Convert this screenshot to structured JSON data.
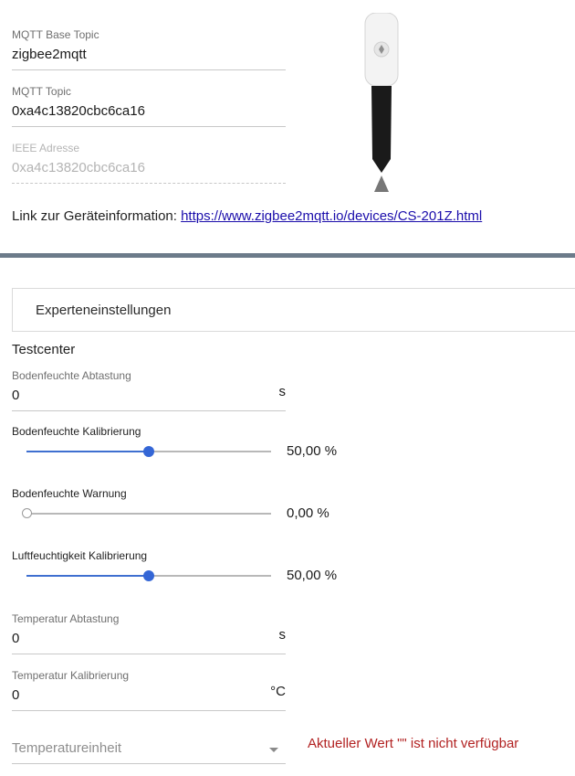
{
  "device_info": {
    "base_topic": {
      "label": "MQTT Base Topic",
      "value": "zigbee2mqtt"
    },
    "topic": {
      "label": "MQTT Topic",
      "value": "0xa4c13820cbc6ca16"
    },
    "ieee": {
      "label": "IEEE Adresse",
      "value": "0xa4c13820cbc6ca16"
    },
    "link_prefix": "Link zur Geräteinformation: ",
    "link_text": "https://www.zigbee2mqtt.io/devices/CS-201Z.html"
  },
  "expert": {
    "label": "Experteneinstellungen"
  },
  "testcenter": {
    "title": "Testcenter",
    "soil_interval": {
      "label": "Bodenfeuchte Abtastung",
      "value": "0",
      "unit": "s"
    },
    "soil_calibration": {
      "label": "Bodenfeuchte Kalibrierung",
      "value_text": "50,00 %",
      "value": 50,
      "min": 0,
      "max": 100
    },
    "soil_warning": {
      "label": "Bodenfeuchte Warnung",
      "value_text": "0,00 %",
      "value": 0,
      "min": 0,
      "max": 100
    },
    "humidity_calibration": {
      "label": "Luftfeuchtigkeit Kalibrierung",
      "value_text": "50,00 %",
      "value": 50,
      "min": 0,
      "max": 100
    },
    "temp_interval": {
      "label": "Temperatur Abtastung",
      "value": "0",
      "unit": "s"
    },
    "temp_calibration": {
      "label": "Temperatur Kalibrierung",
      "value": "0",
      "unit": "°C"
    },
    "temp_unit": {
      "placeholder": "Temperatureinheit",
      "error": "Aktueller Wert \"\" ist nicht verfügbar"
    }
  },
  "colors": {
    "accent": "#3466d6",
    "error": "#b22222",
    "divider": "#6c7b8a"
  }
}
